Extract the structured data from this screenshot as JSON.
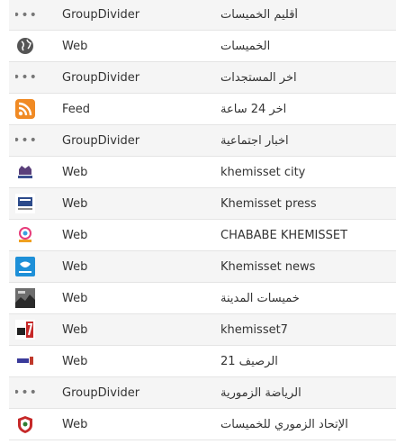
{
  "rows": [
    {
      "icon": "group-divider-icon",
      "type": "GroupDivider",
      "title": "أقليم الخميسات"
    },
    {
      "icon": "globe-icon",
      "type": "Web",
      "title": "الخميسات"
    },
    {
      "icon": "group-divider-icon",
      "type": "GroupDivider",
      "title": "اخر المستجدات"
    },
    {
      "icon": "rss-feed-icon",
      "type": "Feed",
      "title": "اخر 24 ساعة"
    },
    {
      "icon": "group-divider-icon",
      "type": "GroupDivider",
      "title": "اخبار اجتماعية"
    },
    {
      "icon": "site-logo-icon",
      "type": "Web",
      "title": "khemisset city"
    },
    {
      "icon": "site-logo-icon",
      "type": "Web",
      "title": "Khemisset press"
    },
    {
      "icon": "site-logo-icon",
      "type": "Web",
      "title": "CHABABE KHEMISSET"
    },
    {
      "icon": "site-logo-icon",
      "type": "Web",
      "title": "Khemisset news"
    },
    {
      "icon": "site-logo-icon",
      "type": "Web",
      "title": "خميسات المدينة"
    },
    {
      "icon": "site-logo-icon",
      "type": "Web",
      "title": "khemisset7"
    },
    {
      "icon": "site-logo-icon",
      "type": "Web",
      "title": "الرصيف 21"
    },
    {
      "icon": "group-divider-icon",
      "type": "GroupDivider",
      "title": "الرياضة الزمورية"
    },
    {
      "icon": "site-logo-icon",
      "type": "Web",
      "title": "الإتحاد الزموري للخميسات"
    }
  ],
  "dots_glyph": "•••"
}
